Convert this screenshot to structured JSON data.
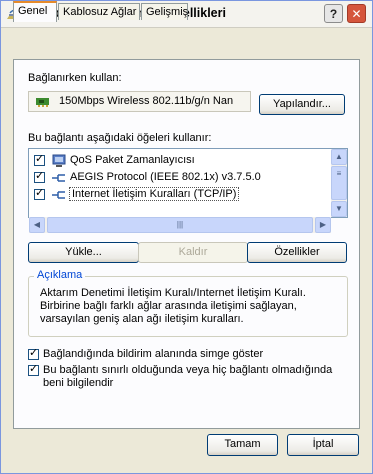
{
  "window": {
    "title": "Kablosuz Ağ Bağlantısı Özellikleri",
    "help_label": "?",
    "close_label": "✕"
  },
  "tabs": [
    {
      "label": "Genel"
    },
    {
      "label": "Kablosuz Ağlar"
    },
    {
      "label": "Gelişmiş"
    }
  ],
  "connect_using": {
    "label": "Bağlanırken kullan:",
    "adapter_name": "150Mbps Wireless 802.11b/g/n Nan",
    "configure_label": "Yapılandır..."
  },
  "components": {
    "label": "Bu bağlantı aşağıdaki öğeleri kullanır:",
    "items": [
      {
        "label": "QoS Paket Zamanlayıcısı",
        "checked": true
      },
      {
        "label": "AEGIS Protocol (IEEE 802.1x) v3.7.5.0",
        "checked": true
      },
      {
        "label": "Internet İletişim Kuralları (TCP/IP)",
        "checked": true
      }
    ],
    "install_label": "Yükle...",
    "uninstall_label": "Kaldır",
    "properties_label": "Özellikler"
  },
  "description": {
    "title": "Açıklama",
    "text": "Aktarım Denetimi İletişim Kuralı/Internet İletişim Kuralı. Birbirine bağlı farklı ağlar arasında iletişimi sağlayan, varsayılan geniş alan ağı iletişim kuralları."
  },
  "options": [
    {
      "label": "Bağlandığında bildirim alanında simge göster",
      "checked": true
    },
    {
      "label": "Bu bağlantı sınırlı olduğunda veya hiç bağlantı olmadığında beni bilgilendir",
      "checked": true
    }
  ],
  "footer": {
    "ok_label": "Tamam",
    "cancel_label": "İptal"
  },
  "colors": {
    "accent": "#e68b2c",
    "group_title": "#0046d5",
    "selection": "#316ac5"
  }
}
